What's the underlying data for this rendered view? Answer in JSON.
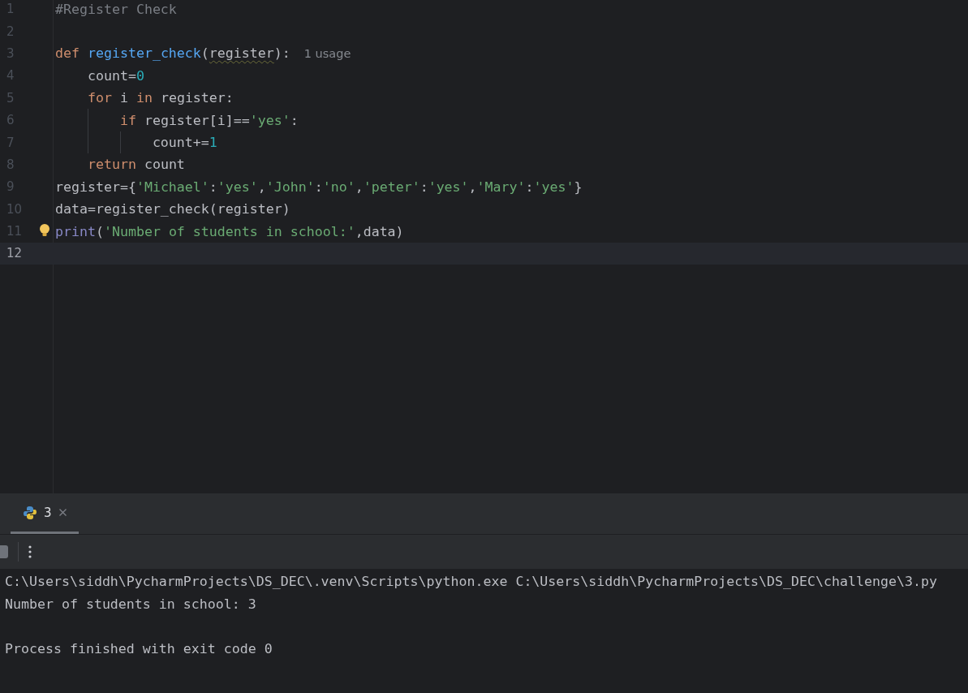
{
  "editor": {
    "lines": [
      {
        "number": "1",
        "current": false,
        "tokens": [
          {
            "text": "#Register Check",
            "kind": "comment"
          }
        ]
      },
      {
        "number": "2",
        "current": false
      },
      {
        "number": "3",
        "current": false,
        "tokens": [
          {
            "text": "def ",
            "kind": "keyword"
          },
          {
            "text": "register_check",
            "kind": "function"
          },
          {
            "text": "(",
            "kind": "plain"
          },
          {
            "text": "register",
            "kind": "warning"
          },
          {
            "text": "):",
            "kind": "plain"
          }
        ],
        "hint": "1 usage"
      },
      {
        "number": "4",
        "current": false,
        "tokens": [
          {
            "text": "    count=",
            "kind": "plain"
          },
          {
            "text": "0",
            "kind": "number"
          }
        ]
      },
      {
        "number": "5",
        "current": false,
        "tokens": [
          {
            "text": "    for ",
            "kind": "keyword"
          },
          {
            "text": "i ",
            "kind": "plain"
          },
          {
            "text": "in ",
            "kind": "keyword"
          },
          {
            "text": "register:",
            "kind": "plain"
          }
        ]
      },
      {
        "number": "6",
        "current": false,
        "tokens": [
          {
            "text": "        if ",
            "kind": "keyword"
          },
          {
            "text": "register[i]==",
            "kind": "plain"
          },
          {
            "text": "'yes'",
            "kind": "string"
          },
          {
            "text": ":",
            "kind": "plain"
          }
        ]
      },
      {
        "number": "7",
        "current": false,
        "tokens": [
          {
            "text": "            count+=",
            "kind": "plain"
          },
          {
            "text": "1",
            "kind": "number"
          }
        ]
      },
      {
        "number": "8",
        "current": false,
        "tokens": [
          {
            "text": "    return ",
            "kind": "keyword"
          },
          {
            "text": "count",
            "kind": "plain"
          }
        ]
      },
      {
        "number": "9",
        "current": false,
        "tokens": [
          {
            "text": "register={",
            "kind": "plain"
          },
          {
            "text": "'Michael'",
            "kind": "string"
          },
          {
            "text": ":",
            "kind": "plain"
          },
          {
            "text": "'yes'",
            "kind": "string"
          },
          {
            "text": ",",
            "kind": "plain"
          },
          {
            "text": "'John'",
            "kind": "string"
          },
          {
            "text": ":",
            "kind": "plain"
          },
          {
            "text": "'no'",
            "kind": "string"
          },
          {
            "text": ",",
            "kind": "plain"
          },
          {
            "text": "'peter'",
            "kind": "string"
          },
          {
            "text": ":",
            "kind": "plain"
          },
          {
            "text": "'yes'",
            "kind": "string"
          },
          {
            "text": ",",
            "kind": "plain"
          },
          {
            "text": "'Mary'",
            "kind": "string"
          },
          {
            "text": ":",
            "kind": "plain"
          },
          {
            "text": "'yes'",
            "kind": "string"
          },
          {
            "text": "}",
            "kind": "plain"
          }
        ]
      },
      {
        "number": "10",
        "current": false,
        "tokens": [
          {
            "text": "data=register_check(register)",
            "kind": "plain"
          }
        ]
      },
      {
        "number": "11",
        "current": false,
        "bulb": true,
        "tokens": [
          {
            "text": "print",
            "kind": "builtin"
          },
          {
            "text": "(",
            "kind": "plain"
          },
          {
            "text": "'Number of students in school:'",
            "kind": "string"
          },
          {
            "text": ",data)",
            "kind": "plain"
          }
        ]
      },
      {
        "number": "12",
        "current": true
      }
    ]
  },
  "run_panel": {
    "tabs": [
      {
        "label": "3",
        "selected": true
      }
    ],
    "console": [
      {
        "kind": "command",
        "text": "C:\\Users\\siddh\\PycharmProjects\\DS_DEC\\.venv\\Scripts\\python.exe C:\\Users\\siddh\\PycharmProjects\\DS_DEC\\challenge\\3.py"
      },
      {
        "kind": "output",
        "text": "Number of students in school: 3"
      },
      {
        "kind": "status",
        "text": "Process finished with exit code 0"
      }
    ]
  }
}
